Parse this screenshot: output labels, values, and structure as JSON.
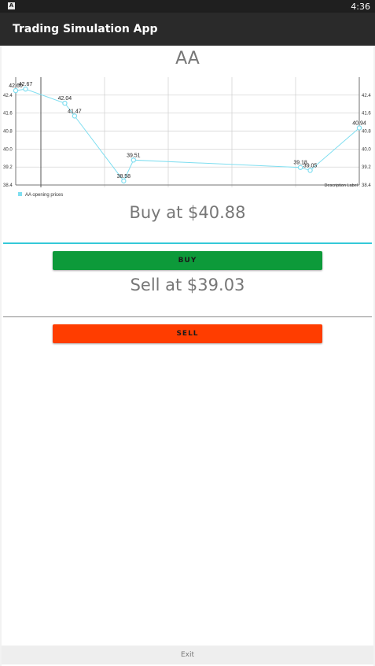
{
  "status_bar": {
    "notification_icon": "A",
    "time": "4:36"
  },
  "app_bar": {
    "title": "Trading Simulation App"
  },
  "stock": {
    "symbol": "AA"
  },
  "chart_data": {
    "type": "line",
    "series": [
      {
        "name": "AA opening prices",
        "values": [
          42.6,
          42.67,
          42.04,
          41.47,
          38.58,
          39.51,
          39.18,
          39.05,
          40.94
        ]
      }
    ],
    "value_labels": [
      "42.60",
      "42.67",
      "42.04",
      "41.47",
      "38.58",
      "39.51",
      "39.18",
      "39.05",
      "40.94"
    ],
    "x": [
      0,
      1,
      5,
      6,
      11,
      12,
      29,
      30,
      35
    ],
    "ylim": [
      38.4,
      43.2
    ],
    "y_ticks": [
      "38.4",
      "39.2",
      "40.0",
      "40.8",
      "41.6",
      "42.4"
    ],
    "y_tick_values": [
      38.4,
      39.2,
      40.0,
      40.8,
      41.6,
      42.4
    ],
    "description_label": "Description Label",
    "grid": true,
    "legend_position": "bottom-left",
    "colors": {
      "line": "#7fdef0",
      "circle_fill": "#ffffff"
    }
  },
  "buy": {
    "price_text": "Buy at $40.88",
    "button_label": "BUY"
  },
  "sell": {
    "price_text": "Sell at $39.03",
    "button_label": "SELL"
  },
  "footer": {
    "exit_label": "Exit"
  },
  "colors": {
    "buy_button": "#0d9a3a",
    "sell_button": "#ff3d00",
    "accent_divider": "#35c9d8"
  }
}
